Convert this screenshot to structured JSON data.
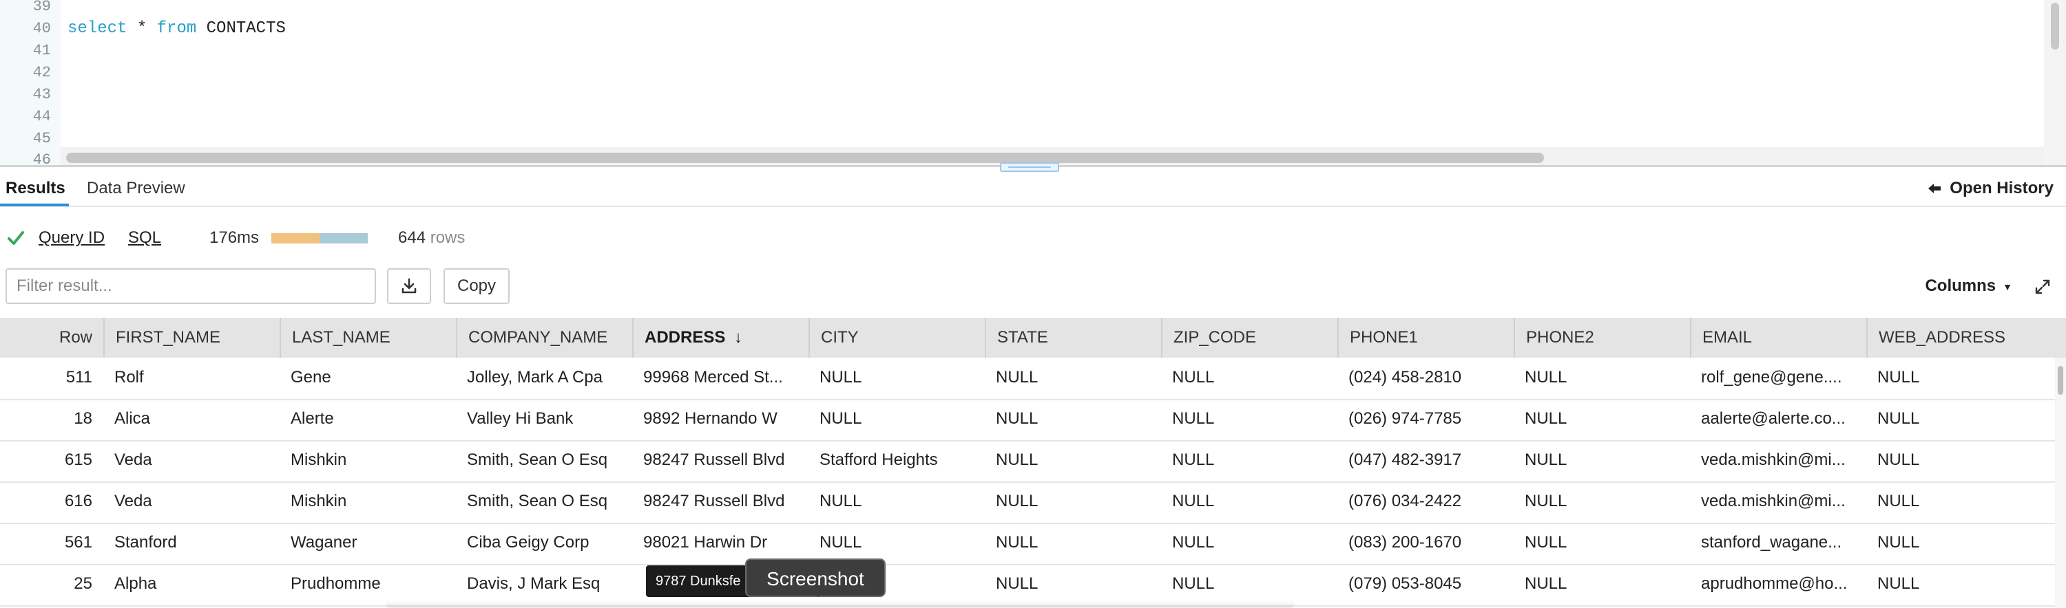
{
  "editor": {
    "lines": [
      {
        "no": "39",
        "code": ""
      },
      {
        "no": "40",
        "code": "select * from CONTACTS"
      },
      {
        "no": "41",
        "code": ""
      },
      {
        "no": "42",
        "code": ""
      },
      {
        "no": "43",
        "code": ""
      },
      {
        "no": "44",
        "code": ""
      },
      {
        "no": "45",
        "code": ""
      },
      {
        "no": "46",
        "code": ""
      }
    ],
    "query": {
      "kw1": "select",
      "mid": " * ",
      "kw2": "from",
      "table": " CONTACTS"
    }
  },
  "tabs": {
    "results": "Results",
    "data_preview": "Data Preview",
    "open_history": "Open History"
  },
  "status": {
    "query_id": "Query ID",
    "sql": "SQL",
    "duration": "176ms",
    "duration_split": [
      0.5,
      0.5
    ],
    "row_count": "644",
    "rows_label": "rows",
    "colors": {
      "compile": "#f1c27d",
      "execute": "#a9cbd9",
      "success": "#3aa757"
    }
  },
  "toolbar": {
    "filter_placeholder": "Filter result...",
    "download_icon": "download-icon",
    "copy_label": "Copy",
    "columns_label": "Columns",
    "expand_icon": "expand-icon"
  },
  "grid": {
    "sorted_column": "ADDRESS",
    "sort_direction": "descending",
    "columns": [
      "Row",
      "FIRST_NAME",
      "LAST_NAME",
      "COMPANY_NAME",
      "ADDRESS",
      "CITY",
      "STATE",
      "ZIP_CODE",
      "PHONE1",
      "PHONE2",
      "EMAIL",
      "WEB_ADDRESS"
    ],
    "rows": [
      [
        "511",
        "Rolf",
        "Gene",
        "Jolley, Mark A Cpa",
        "99968 Merced St...",
        "NULL",
        "NULL",
        "NULL",
        "(024) 458-2810",
        "NULL",
        "rolf_gene@gene....",
        "NULL"
      ],
      [
        "18",
        "Alica",
        "Alerte",
        "Valley Hi Bank",
        "9892 Hernando W",
        "NULL",
        "NULL",
        "NULL",
        "(026) 974-7785",
        "NULL",
        "aalerte@alerte.co...",
        "NULL"
      ],
      [
        "615",
        "Veda",
        "Mishkin",
        "Smith, Sean O Esq",
        "98247 Russell Blvd",
        "Stafford Heights",
        "NULL",
        "NULL",
        "(047) 482-3917",
        "NULL",
        "veda.mishkin@mi...",
        "NULL"
      ],
      [
        "616",
        "Veda",
        "Mishkin",
        "Smith, Sean O Esq",
        "98247 Russell Blvd",
        "NULL",
        "NULL",
        "NULL",
        "(076) 034-2422",
        "NULL",
        "veda.mishkin@mi...",
        "NULL"
      ],
      [
        "561",
        "Stanford",
        "Waganer",
        "Ciba Geigy Corp",
        "98021 Harwin Dr",
        "NULL",
        "NULL",
        "NULL",
        "(083) 200-1670",
        "NULL",
        "stanford_wagane...",
        "NULL"
      ],
      [
        "25",
        "Alpha",
        "Prudhomme",
        "Davis, J Mark Esq",
        "",
        "",
        "NULL",
        "NULL",
        "(079) 053-8045",
        "NULL",
        "aprudhomme@ho...",
        "NULL"
      ]
    ]
  },
  "tooltips": {
    "address": "9787 Dunksfe",
    "screenshot": "Screenshot"
  }
}
